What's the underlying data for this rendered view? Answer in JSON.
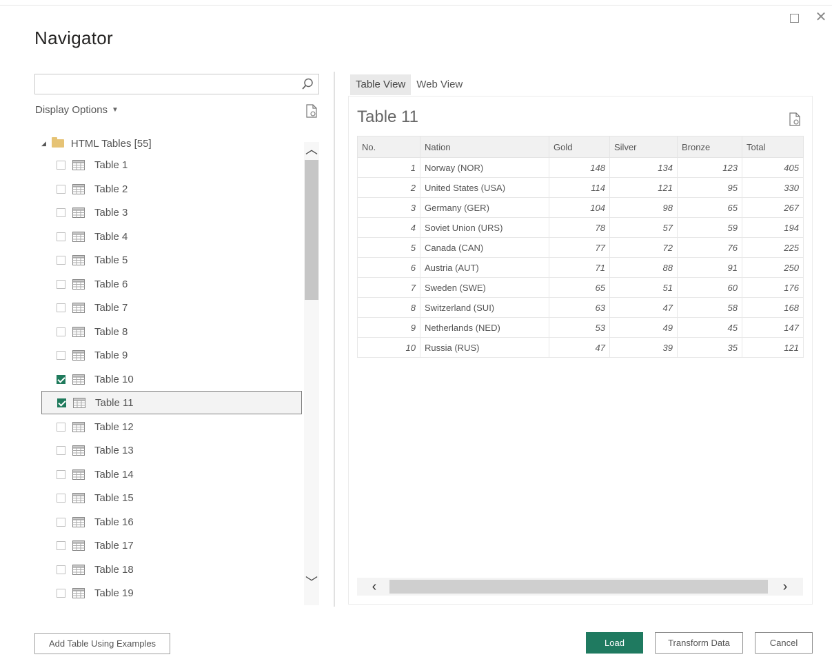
{
  "window": {
    "title": "Navigator",
    "maximize_glyph": "",
    "close_glyph": "✕"
  },
  "left": {
    "search": {
      "value": "",
      "placeholder": ""
    },
    "display_options": "Display Options",
    "root_label": "HTML Tables [55]",
    "items": [
      {
        "label": "Table 1",
        "checked": false
      },
      {
        "label": "Table 2",
        "checked": false
      },
      {
        "label": "Table 3",
        "checked": false
      },
      {
        "label": "Table 4",
        "checked": false
      },
      {
        "label": "Table 5",
        "checked": false
      },
      {
        "label": "Table 6",
        "checked": false
      },
      {
        "label": "Table 7",
        "checked": false
      },
      {
        "label": "Table 8",
        "checked": false
      },
      {
        "label": "Table 9",
        "checked": false
      },
      {
        "label": "Table 10",
        "checked": true
      },
      {
        "label": "Table 11",
        "checked": true,
        "selected": true
      },
      {
        "label": "Table 12",
        "checked": false
      },
      {
        "label": "Table 13",
        "checked": false
      },
      {
        "label": "Table 14",
        "checked": false
      },
      {
        "label": "Table 15",
        "checked": false
      },
      {
        "label": "Table 16",
        "checked": false
      },
      {
        "label": "Table 17",
        "checked": false
      },
      {
        "label": "Table 18",
        "checked": false
      },
      {
        "label": "Table 19",
        "checked": false
      }
    ]
  },
  "right": {
    "tabs": [
      {
        "label": "Table View",
        "active": true
      },
      {
        "label": "Web View",
        "active": false
      }
    ],
    "preview_title": "Table 11",
    "columns": [
      "No.",
      "Nation",
      "Gold",
      "Silver",
      "Bronze",
      "Total"
    ],
    "rows": [
      [
        "1",
        "Norway (NOR)",
        "148",
        "134",
        "123",
        "405"
      ],
      [
        "2",
        "United States (USA)",
        "114",
        "121",
        "95",
        "330"
      ],
      [
        "3",
        "Germany (GER)",
        "104",
        "98",
        "65",
        "267"
      ],
      [
        "4",
        "Soviet Union (URS)",
        "78",
        "57",
        "59",
        "194"
      ],
      [
        "5",
        "Canada (CAN)",
        "77",
        "72",
        "76",
        "225"
      ],
      [
        "6",
        "Austria (AUT)",
        "71",
        "88",
        "91",
        "250"
      ],
      [
        "7",
        "Sweden (SWE)",
        "65",
        "51",
        "60",
        "176"
      ],
      [
        "8",
        "Switzerland (SUI)",
        "63",
        "47",
        "58",
        "168"
      ],
      [
        "9",
        "Netherlands (NED)",
        "53",
        "49",
        "45",
        "147"
      ],
      [
        "10",
        "Russia (RUS)",
        "47",
        "39",
        "35",
        "121"
      ]
    ]
  },
  "footer": {
    "add_table": "Add Table Using Examples",
    "load": "Load",
    "transform": "Transform Data",
    "cancel": "Cancel"
  },
  "colors": {
    "accent": "#1f7a60",
    "folder": "#e6c375"
  }
}
